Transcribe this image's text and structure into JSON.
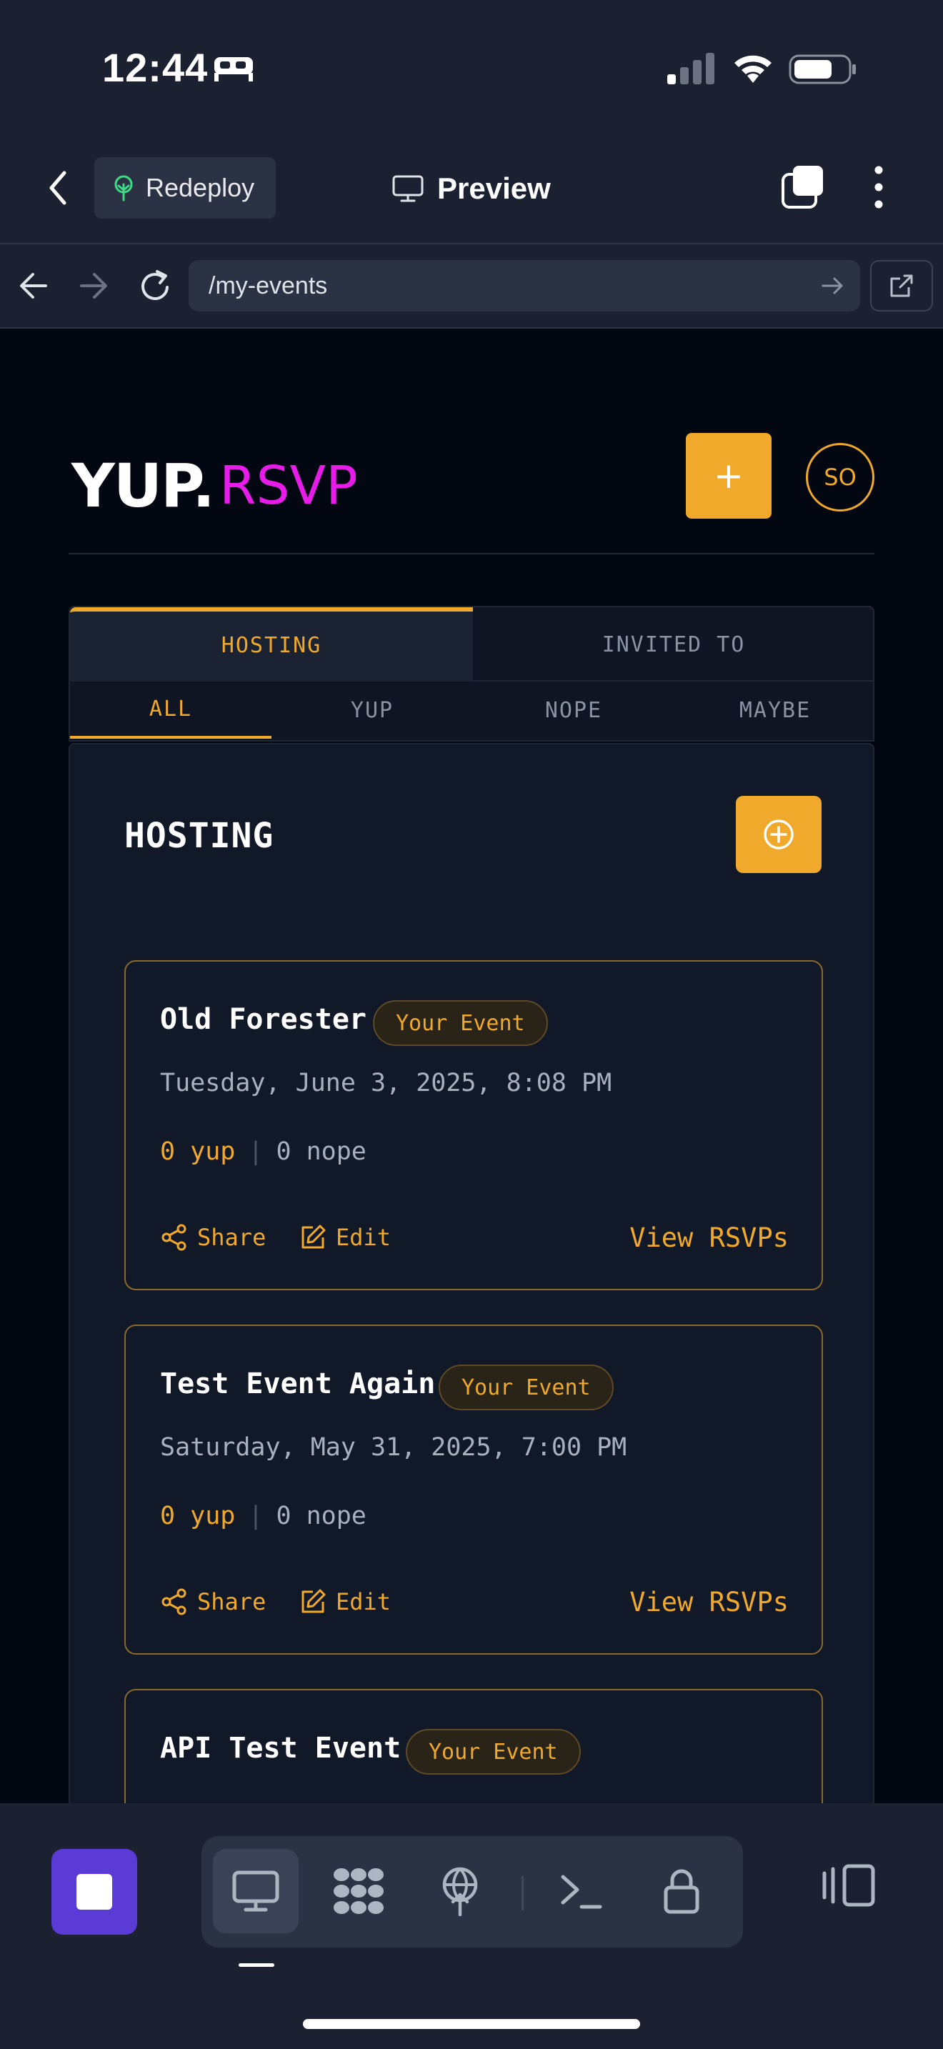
{
  "status_bar": {
    "time": "12:44",
    "icons": [
      "bed-icon",
      "signal-icon",
      "wifi-icon",
      "battery-icon"
    ]
  },
  "app_bar": {
    "redeploy_label": "Redeploy",
    "preview_label": "Preview",
    "icons": [
      "back-chevron-icon",
      "tree-icon",
      "monitor-icon",
      "tabs-icon",
      "kebab-menu-icon"
    ]
  },
  "url_bar": {
    "url": "/my-events",
    "icons": [
      "arrow-left-icon",
      "arrow-right-icon",
      "reload-icon",
      "go-arrow-icon",
      "external-link-icon"
    ]
  },
  "site": {
    "logo_main": "YUP.",
    "logo_accent": "RSVP",
    "create_label": "+",
    "avatar_initials": "SO",
    "brand_color": "#f0a92b",
    "logo_accent_color": "#e81ce8",
    "tabs": [
      {
        "label": "HOSTING",
        "active": true
      },
      {
        "label": "INVITED TO",
        "active": false
      }
    ],
    "subtabs": [
      {
        "label": "ALL",
        "active": true
      },
      {
        "label": "YUP",
        "active": false
      },
      {
        "label": "NOPE",
        "active": false
      },
      {
        "label": "MAYBE",
        "active": false
      }
    ],
    "panel_title": "HOSTING",
    "events": [
      {
        "title": "Old Forester",
        "badge": "Your Event",
        "date": "Tuesday, June 3, 2025, 8:08 PM",
        "yup": "0 yup",
        "separator": "|",
        "nope": "0 nope",
        "share": "Share",
        "edit": "Edit",
        "view": "View RSVPs"
      },
      {
        "title": "Test Event Again",
        "badge": "Your Event",
        "date": "Saturday, May 31, 2025, 7:00 PM",
        "yup": "0 yup",
        "separator": "|",
        "nope": "0 nope",
        "share": "Share",
        "edit": "Edit",
        "view": "View RSVPs"
      },
      {
        "title": "API Test Event",
        "badge": "Your Event"
      }
    ]
  },
  "bottom_toolbar": {
    "icons": [
      "stop-icon",
      "desktop-icon",
      "grid-dots-icon",
      "globe-upload-icon",
      "terminal-icon",
      "lock-icon",
      "side-panel-icon"
    ],
    "active_tool": "desktop-icon"
  }
}
